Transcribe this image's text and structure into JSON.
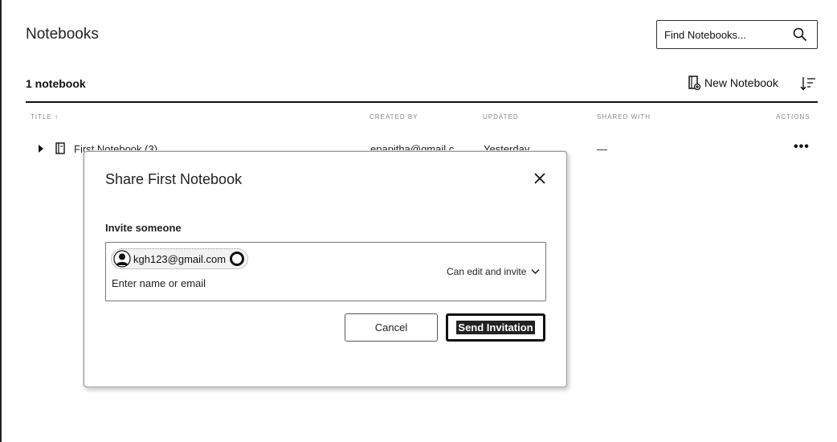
{
  "header": {
    "title": "Notebooks",
    "search_placeholder": "Find Notebooks..."
  },
  "toolbar": {
    "count_label": "1 notebook",
    "new_notebook_label": "New Notebook"
  },
  "table": {
    "columns": [
      "TITLE ↑",
      "CREATED BY",
      "UPDATED",
      "SHARED WITH",
      "ACTIONS"
    ],
    "rows": [
      {
        "title": "First Notebook (3)",
        "created_by": "epapitha@gmail.c",
        "updated": "Yesterday",
        "shared_with": "—",
        "actions": "•••"
      }
    ]
  },
  "share_dialog": {
    "title": "Share First Notebook",
    "invite_label": "Invite someone",
    "chip_email": "kgh123@gmail.com",
    "input_placeholder": "Enter name or email",
    "permission": "Can edit and invite",
    "cancel_label": "Cancel",
    "send_label": "Send Invitation"
  }
}
